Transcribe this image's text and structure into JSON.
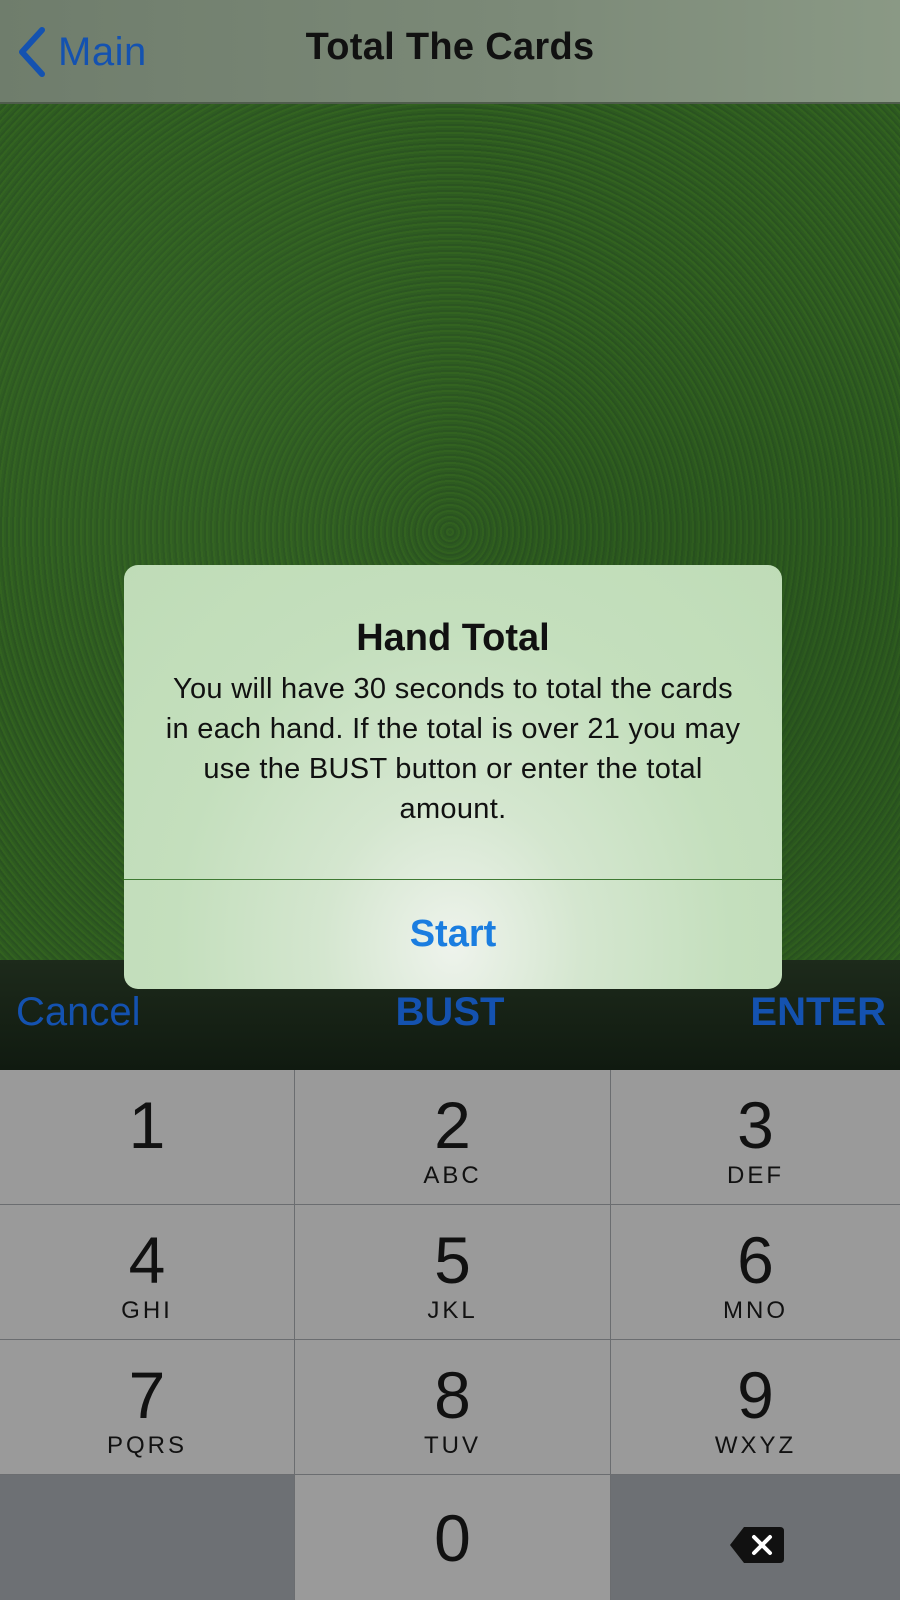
{
  "navbar": {
    "back_label": "Main",
    "title": "Total The Cards"
  },
  "accessory_bar": {
    "cancel_label": "Cancel",
    "bust_label": "BUST",
    "enter_label": "ENTER"
  },
  "keypad": {
    "keys": [
      {
        "digit": "1",
        "letters": ""
      },
      {
        "digit": "2",
        "letters": "ABC"
      },
      {
        "digit": "3",
        "letters": "DEF"
      },
      {
        "digit": "4",
        "letters": "GHI"
      },
      {
        "digit": "5",
        "letters": "JKL"
      },
      {
        "digit": "6",
        "letters": "MNO"
      },
      {
        "digit": "7",
        "letters": "PQRS"
      },
      {
        "digit": "8",
        "letters": "TUV"
      },
      {
        "digit": "9",
        "letters": "WXYZ"
      },
      {
        "digit": "0",
        "letters": ""
      }
    ],
    "delete_icon": "backspace-icon"
  },
  "alert": {
    "title": "Hand Total",
    "message": "You will have 30 seconds to total the cards in each hand. If the total is over 21 you may use the BUST button or enter the total amount.",
    "button_label": "Start"
  },
  "colors": {
    "accent_blue": "#1452b0",
    "alert_button_blue": "#1a7de0",
    "felt_green": "#2f5a22"
  }
}
